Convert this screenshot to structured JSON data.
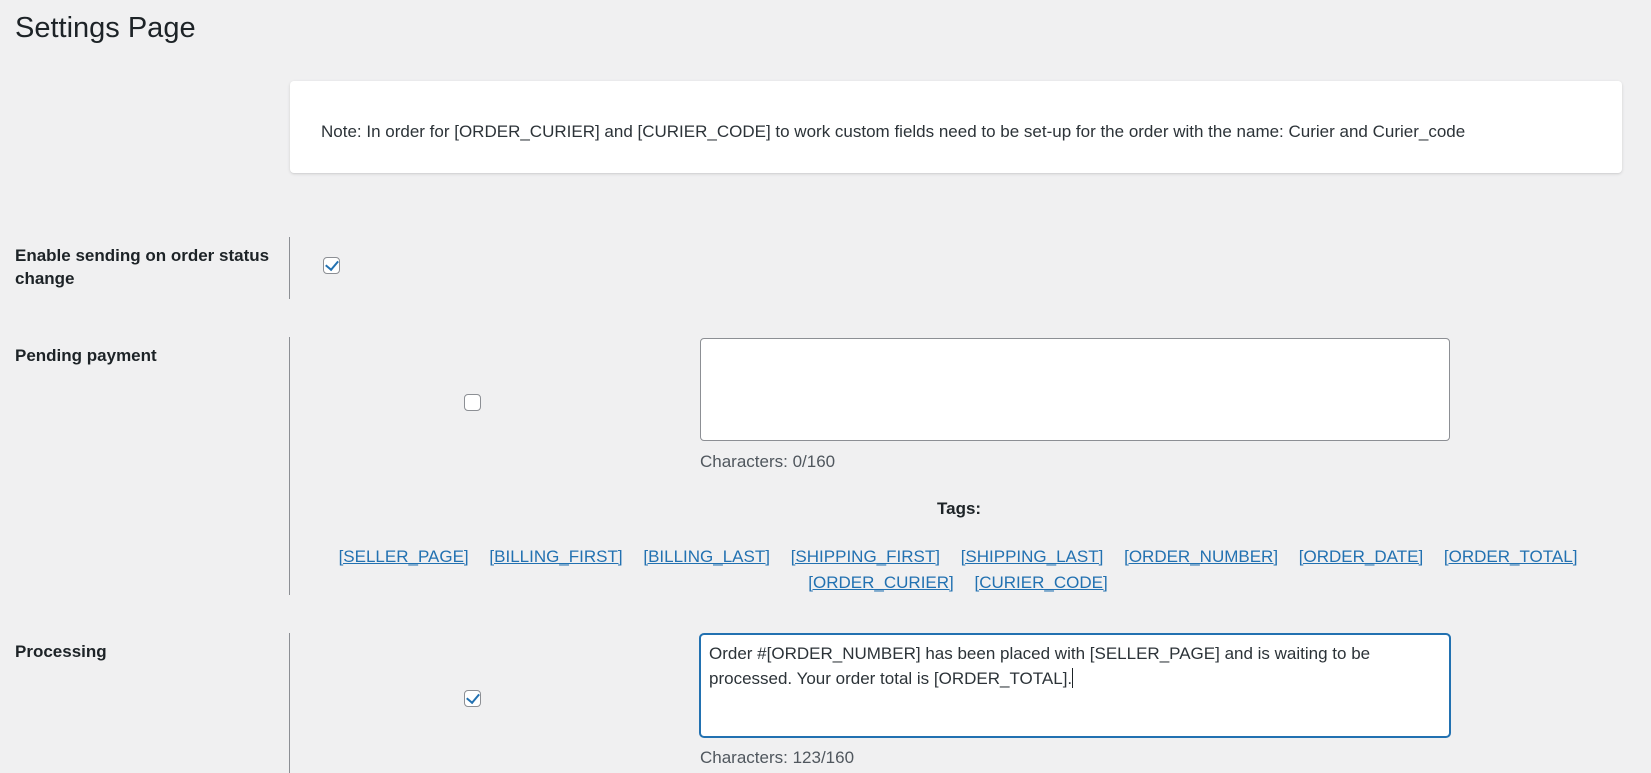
{
  "page": {
    "title": "Settings Page"
  },
  "notice": {
    "text": "Note: In order for [ORDER_CURIER] and [CURIER_CODE] to work custom fields need to be set-up for the order with the name: Curier and Curier_code"
  },
  "enable_sending": {
    "label": "Enable sending on order status change",
    "checked": true
  },
  "statuses": [
    {
      "label": "Pending payment",
      "enabled": false,
      "message": "",
      "characters_text": "Characters: 0/160"
    },
    {
      "label": "Processing",
      "enabled": true,
      "message": "Order #[ORDER_NUMBER] has been placed with [SELLER_PAGE] and is waiting to be processed. Your order total is [ORDER_TOTAL].",
      "characters_text": "Characters: 123/160"
    }
  ],
  "tags": {
    "title": "Tags:",
    "items": [
      "[SELLER_PAGE]",
      "[BILLING_FIRST]",
      "[BILLING_LAST]",
      "[SHIPPING_FIRST]",
      "[SHIPPING_LAST]",
      "[ORDER_NUMBER]",
      "[ORDER_DATE]",
      "[ORDER_TOTAL]",
      "[ORDER_CURIER]",
      "[CURIER_CODE]"
    ]
  },
  "colors": {
    "background": "#f0f0f1",
    "accent": "#2271b1",
    "text": "#1d2327"
  }
}
